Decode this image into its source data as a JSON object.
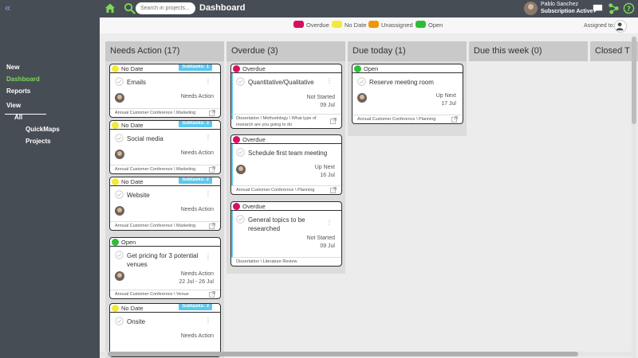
{
  "topbar": {
    "search_placeholder": "Search in projects...",
    "page_title": "Dashboard",
    "user_name": "Pablo Sanchez",
    "user_subscription": "Subscription Active"
  },
  "sidebar": {
    "items": [
      {
        "label": "New"
      },
      {
        "label": "Dashboard"
      },
      {
        "label": "Reports"
      },
      {
        "label": "View"
      },
      {
        "label": "All"
      },
      {
        "label": "QuickMaps"
      },
      {
        "label": "Projects"
      }
    ]
  },
  "legend": {
    "items": [
      {
        "label": "Overdue",
        "color": "#d6105e"
      },
      {
        "label": "No Date",
        "color": "#f2ea3b"
      },
      {
        "label": "Unassigned",
        "color": "#f0960a"
      },
      {
        "label": "Open",
        "color": "#2ebd3a"
      }
    ],
    "assigned_label": "Assigned to:"
  },
  "columns": [
    {
      "title": "Needs Action (17)",
      "cards": [
        {
          "status": "No Date",
          "status_color": "#f2ea3b",
          "subtasks": "Subtasks: 1",
          "title": "Emails",
          "state": "Needs Action",
          "date": "",
          "footer": "Annual Customer Conference \\ Marketing"
        },
        {
          "status": "No Date",
          "status_color": "#f2ea3b",
          "subtasks": "Subtasks: 3",
          "title": "Social media",
          "state": "Needs Action",
          "date": "",
          "footer": "Annual Customer Conference \\ Marketing"
        },
        {
          "status": "No Date",
          "status_color": "#f2ea3b",
          "subtasks": "Subtasks: 2",
          "title": "Website",
          "state": "Needs Action",
          "date": "",
          "footer": "Annual Customer Conference \\ Marketing"
        },
        {
          "status": "Open",
          "status_color": "#2ebd3a",
          "subtasks": "",
          "title": "Get pricing for 3 potential venues",
          "state": "Needs Action",
          "date": "22 Jul - 26 Jul",
          "footer": "Annual Customer Conference \\ Venue"
        },
        {
          "status": "No Date",
          "status_color": "#f2ea3b",
          "subtasks": "Subtasks: 3",
          "title": "Onsite",
          "state": "Needs Action",
          "date": "",
          "footer": ""
        }
      ]
    },
    {
      "title": "Overdue (3)",
      "cards": [
        {
          "status": "Overdue",
          "status_color": "#d6105e",
          "subtasks": "",
          "title": "Quantitative/Qualitative",
          "state": "Not Started",
          "date": "09 Jul",
          "footer": "Dissertation \\ Methodology \\ What type of research are you going to do"
        },
        {
          "status": "Overdue",
          "status_color": "#d6105e",
          "subtasks": "",
          "title": "Schedule first team meeting",
          "state": "Up Next",
          "date": "16 Jul",
          "footer": "Annual Customer Conference \\ Planning"
        },
        {
          "status": "Overdue",
          "status_color": "#d6105e",
          "subtasks": "",
          "title": "General topics to be researched",
          "state": "Not Started",
          "date": "09 Jul",
          "footer": "Dissertation \\ Literature Review"
        }
      ]
    },
    {
      "title": "Due today (1)",
      "cards": [
        {
          "status": "Open",
          "status_color": "#2ebd3a",
          "subtasks": "",
          "title": "Reserve meeting room",
          "state": "Up Next",
          "date": "17 Jul",
          "footer": "Annual Customer Conference \\ Planning"
        }
      ]
    },
    {
      "title": "Due this week (0)",
      "cards": []
    },
    {
      "title": "Closed T",
      "cards": []
    }
  ]
}
